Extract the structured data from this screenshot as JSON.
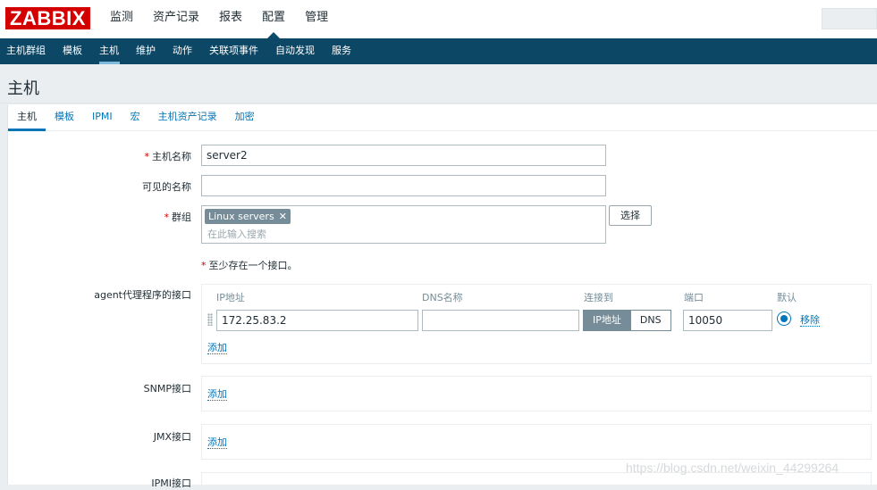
{
  "app": {
    "logo": "ZABBIX"
  },
  "main_menu": [
    {
      "label": "监测"
    },
    {
      "label": "资产记录"
    },
    {
      "label": "报表"
    },
    {
      "label": "配置",
      "active": true
    },
    {
      "label": "管理"
    }
  ],
  "sub_menu": [
    {
      "label": "主机群组"
    },
    {
      "label": "模板"
    },
    {
      "label": "主机",
      "active": true
    },
    {
      "label": "维护"
    },
    {
      "label": "动作"
    },
    {
      "label": "关联项事件"
    },
    {
      "label": "自动发现"
    },
    {
      "label": "服务"
    }
  ],
  "page": {
    "title": "主机"
  },
  "tabs": [
    {
      "label": "主机",
      "active": true
    },
    {
      "label": "模板"
    },
    {
      "label": "IPMI"
    },
    {
      "label": "宏"
    },
    {
      "label": "主机资产记录"
    },
    {
      "label": "加密"
    }
  ],
  "form": {
    "host_name": {
      "label": "主机名称",
      "value": "server2"
    },
    "visible_name": {
      "label": "可见的名称",
      "value": ""
    },
    "groups": {
      "label": "群组",
      "tag": "Linux servers",
      "placeholder": "在此输入搜索",
      "select_button": "选择"
    },
    "interface_note": "至少存在一个接口。",
    "agent": {
      "label": "agent代理程序的接口",
      "headers": {
        "ip": "IP地址",
        "dns": "DNS名称",
        "connect": "连接到",
        "port": "端口",
        "default": "默认"
      },
      "ip": "172.25.83.2",
      "dns": "",
      "connect_ip": "IP地址",
      "connect_dns": "DNS",
      "port": "10050",
      "remove": "移除",
      "add": "添加"
    },
    "snmp": {
      "label": "SNMP接口",
      "add": "添加"
    },
    "jmx": {
      "label": "JMX接口",
      "add": "添加"
    },
    "ipmi": {
      "label": "IPMI接口"
    }
  },
  "watermark": "https://blog.csdn.net/weixin_44299264"
}
